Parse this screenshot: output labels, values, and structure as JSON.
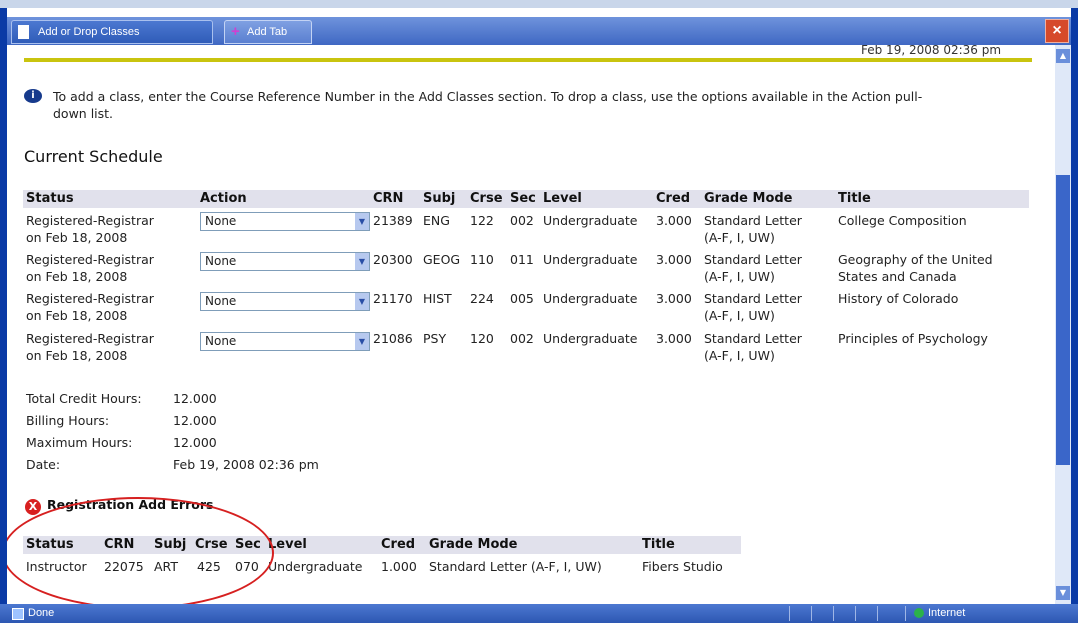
{
  "browser": {
    "active_tab": "Add or Drop Classes",
    "add_tab": "Add Tab",
    "close_glyph": "×",
    "status_left": "Done",
    "status_zone": "Internet"
  },
  "page": {
    "timestamp_top": "Feb 19, 2008 02:36 pm",
    "info_line1": "To add a class, enter the Course Reference Number in the Add Classes section. To drop a class, use the options available in the Action pull-",
    "info_line2": "down list.",
    "section_title": "Current Schedule"
  },
  "schedule": {
    "headers": {
      "status": "Status",
      "action": "Action",
      "crn": "CRN",
      "subj": "Subj",
      "crse": "Crse",
      "sec": "Sec",
      "level": "Level",
      "cred": "Cred",
      "grade_mode": "Grade Mode",
      "title": "Title"
    },
    "rows": [
      {
        "status1": "Registered-Registrar",
        "status2": "on Feb 18, 2008",
        "action": "None",
        "crn": "21389",
        "subj": "ENG",
        "crse": "122",
        "sec": "002",
        "level": "Undergraduate",
        "cred": "3.000",
        "grade1": "Standard Letter",
        "grade2": "(A-F, I, UW)",
        "title1": "College Composition",
        "title2": ""
      },
      {
        "status1": "Registered-Registrar",
        "status2": "on Feb 18, 2008",
        "action": "None",
        "crn": "20300",
        "subj": "GEOG",
        "crse": "110",
        "sec": "011",
        "level": "Undergraduate",
        "cred": "3.000",
        "grade1": "Standard Letter",
        "grade2": "(A-F, I, UW)",
        "title1": "Geography of the United",
        "title2": "States and Canada"
      },
      {
        "status1": "Registered-Registrar",
        "status2": "on Feb 18, 2008",
        "action": "None",
        "crn": "21170",
        "subj": "HIST",
        "crse": "224",
        "sec": "005",
        "level": "Undergraduate",
        "cred": "3.000",
        "grade1": "Standard Letter",
        "grade2": "(A-F, I, UW)",
        "title1": "History of Colorado",
        "title2": ""
      },
      {
        "status1": "Registered-Registrar",
        "status2": "on Feb 18, 2008",
        "action": "None",
        "crn": "21086",
        "subj": "PSY",
        "crse": "120",
        "sec": "002",
        "level": "Undergraduate",
        "cred": "3.000",
        "grade1": "Standard Letter",
        "grade2": "(A-F, I, UW)",
        "title1": "Principles of Psychology",
        "title2": ""
      }
    ]
  },
  "summary": {
    "total_label": "Total Credit Hours:",
    "total_value": "12.000",
    "billing_label": "Billing Hours:",
    "billing_value": "12.000",
    "max_label": "Maximum Hours:",
    "max_value": "12.000",
    "date_label": "Date:",
    "date_value": "Feb 19, 2008 02:36 pm"
  },
  "errors": {
    "title": "Registration Add Errors",
    "headers": {
      "status": "Status",
      "crn": "CRN",
      "subj": "Subj",
      "crse": "Crse",
      "sec": "Sec",
      "level": "Level",
      "cred": "Cred",
      "grade_mode": "Grade Mode",
      "title": "Title"
    },
    "row": {
      "status": "Instructor",
      "crn": "22075",
      "subj": "ART",
      "crse": "425",
      "sec": "070",
      "level": "Undergraduate",
      "cred": "1.000",
      "grade_mode": "Standard Letter (A-F, I, UW)",
      "title": "Fibers Studio"
    }
  },
  "colors": {
    "accent_bar": "#c9c40f",
    "frame": "#0a3aa6",
    "error_ring": "#d62020"
  }
}
